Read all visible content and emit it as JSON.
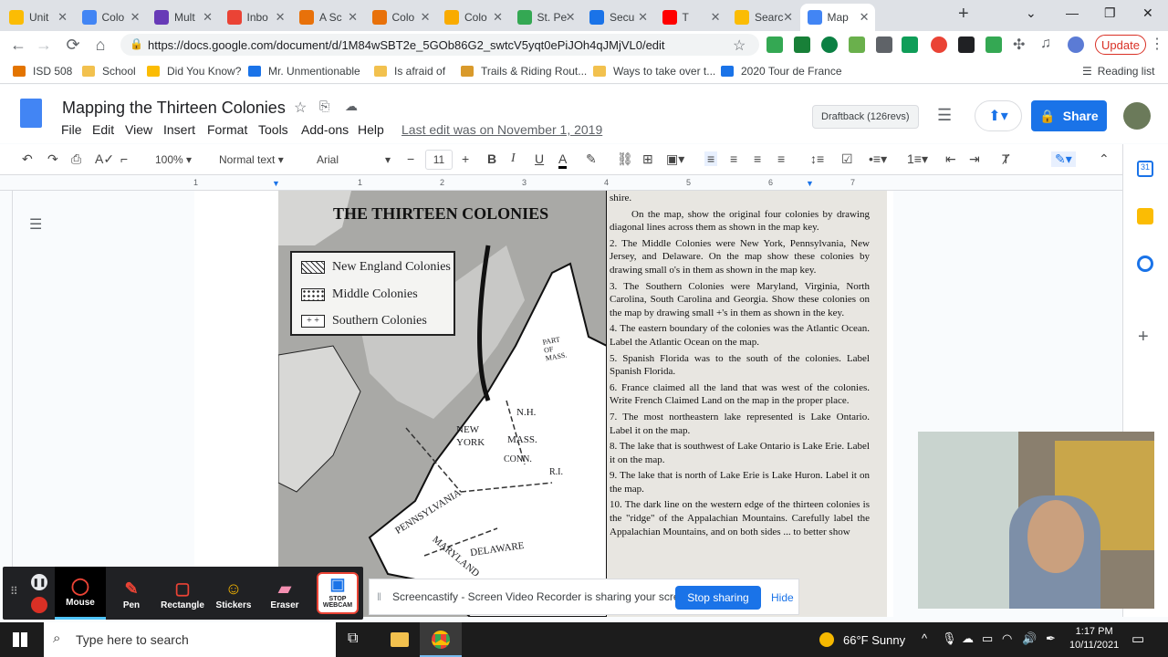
{
  "browser": {
    "tabs": [
      {
        "label": "Unit",
        "icon": "drive-icon",
        "color": "#fbbc04"
      },
      {
        "label": "Colo",
        "icon": "docs-icon",
        "color": "#4285f4"
      },
      {
        "label": "Mult",
        "icon": "forms-icon",
        "color": "#673ab7"
      },
      {
        "label": "Inbo",
        "icon": "gmail-icon",
        "color": "#ea4335"
      },
      {
        "label": "A Sc",
        "icon": "slides-icon",
        "color": "#e8710a"
      },
      {
        "label": "Colo",
        "icon": "slides-icon",
        "color": "#e8710a"
      },
      {
        "label": "Colo",
        "icon": "classroom-icon",
        "color": "#f9ab00"
      },
      {
        "label": "St. Pe",
        "icon": "sheets-icon",
        "color": "#34a853"
      },
      {
        "label": "Secu",
        "icon": "screen-icon",
        "color": "#1a73e8"
      },
      {
        "label": "T",
        "icon": "youtube-icon",
        "color": "#ff0000"
      },
      {
        "label": "Searc",
        "icon": "drive-icon",
        "color": "#fbbc04"
      },
      {
        "label": "Map",
        "icon": "docs-icon",
        "color": "#4285f4"
      }
    ],
    "url": "https://docs.google.com/document/d/1M84wSBT2e_5GOb86G2_swtcV5yqt0ePiJOh4qJMjVL0/edit",
    "update_label": "Update",
    "bookmarks": [
      "ISD 508",
      "School",
      "Did You Know?",
      "Mr. Unmentionable",
      "Is afraid of",
      "Trails & Riding Rout...",
      "Ways to take over t...",
      "2020 Tour de France"
    ],
    "reading_list": "Reading list"
  },
  "docs": {
    "title": "Mapping the Thirteen Colonies",
    "menus": [
      "File",
      "Edit",
      "View",
      "Insert",
      "Format",
      "Tools",
      "Add-ons",
      "Help"
    ],
    "last_edit": "Last edit was on November 1, 2019",
    "draftback": "Draftback (126revs)",
    "share_label": "Share",
    "toolbar": {
      "zoom": "100%",
      "style": "Normal text",
      "font": "Arial",
      "size": "11"
    },
    "ruler_marks": [
      "1",
      "1",
      "2",
      "3",
      "4",
      "5",
      "6",
      "7"
    ]
  },
  "worksheet": {
    "map_title": "THE THIRTEEN COLONIES",
    "legend": [
      "New England Colonies",
      "Middle Colonies",
      "Southern Colonies"
    ],
    "map_labels": [
      "PART OF MASS.",
      "N.H.",
      "NEW YORK",
      "MASS.",
      "CONN.",
      "R.I.",
      "PENNSYLVANIA",
      "MARYLAND",
      "DELAWARE"
    ],
    "paragraphs": [
      "shire.",
      "On the map, show the original four colonies by drawing diagonal lines across them as shown in the map key.",
      "2. The Middle Colonies were New York, Pennsylvania, New Jersey, and Delaware. On the map show these colonies by drawing small o's in them as shown in the map key.",
      "3. The Southern Colonies were Maryland, Virginia, North Carolina, South Carolina and Georgia. Show these colonies on the map by drawing small +'s in them as shown in the key.",
      "4. The eastern boundary of the colonies was the Atlantic Ocean. Label the Atlantic Ocean on the map.",
      "5. Spanish Florida was to the south of the colonies. Label Spanish Florida.",
      "6. France claimed all the land that was west of the colonies. Write French Claimed Land on the map in the proper place.",
      "7. The most northeastern lake represented is Lake Ontario. Label it on the map.",
      "8. The lake that is southwest of Lake Ontario is Lake Erie. Label it on the map.",
      "9. The lake that is north of Lake Erie is Lake Huron. Label it on the map.",
      "10. The dark line on the western edge of the thirteen colonies is the \"ridge\" of the Appalachian Mountains. Carefully label the Appalachian Mountains, and on both sides ... to better show"
    ]
  },
  "recorder": {
    "tools": [
      "Mouse",
      "Pen",
      "Rectangle",
      "Stickers",
      "Eraser",
      "STOP WEBCAM"
    ],
    "share_message": "Screencastify - Screen Video Recorder is sharing your screen.",
    "stop_sharing": "Stop sharing",
    "hide": "Hide"
  },
  "taskbar": {
    "search_placeholder": "Type here to search",
    "weather": "66°F Sunny",
    "time": "1:17 PM",
    "date": "10/11/2021"
  }
}
